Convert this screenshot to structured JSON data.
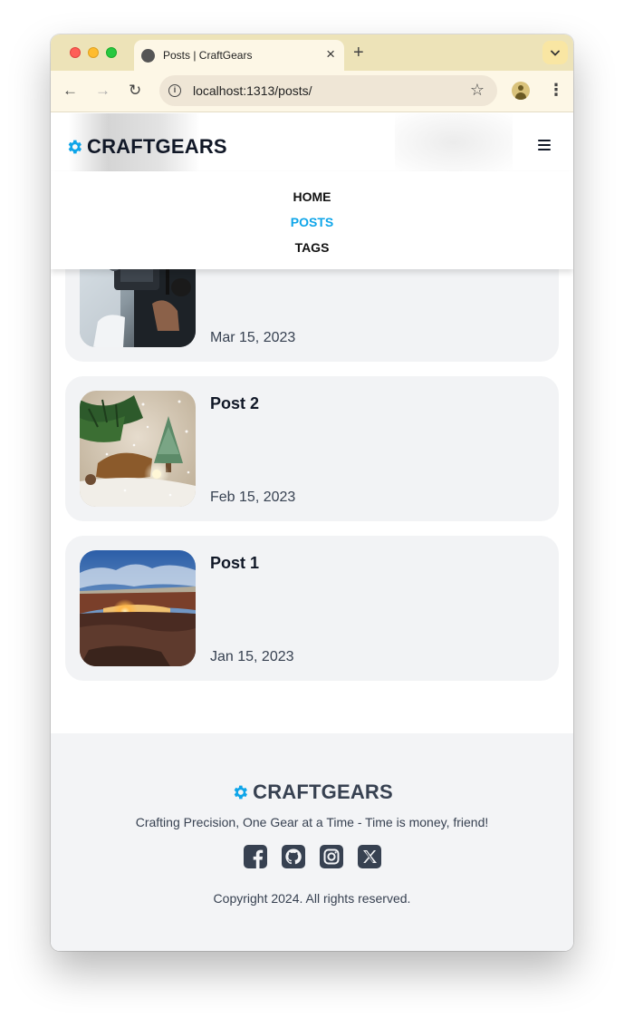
{
  "browser": {
    "tab_title": "Posts | CraftGears",
    "tab_close": "×",
    "new_tab": "+",
    "url": "localhost:1313/posts/",
    "back": "←",
    "forward": "→",
    "reload": "↻",
    "star": "☆",
    "info": "i",
    "menu": "⋮",
    "tab_dropdown": "⌄"
  },
  "site": {
    "brand": "CRAFTGEARS",
    "accent_color": "#0ea5e9",
    "nav": [
      {
        "label": "HOME",
        "active": false
      },
      {
        "label": "POSTS",
        "active": true
      },
      {
        "label": "TAGS",
        "active": false
      }
    ]
  },
  "posts": [
    {
      "title": "",
      "date": "Mar 15, 2023",
      "thumb": "camera-gear-photo"
    },
    {
      "title": "Post 2",
      "date": "Feb 15, 2023",
      "thumb": "christmas-tree-photo"
    },
    {
      "title": "Post 1",
      "date": "Jan 15, 2023",
      "thumb": "mesa-arch-sunset-photo"
    }
  ],
  "footer": {
    "brand": "CRAFTGEARS",
    "tagline": "Crafting Precision, One Gear at a Time - Time is money, friend!",
    "socials": [
      "facebook-icon",
      "github-icon",
      "instagram-icon",
      "x-icon"
    ],
    "copyright": "Copyright 2024. All rights reserved."
  }
}
